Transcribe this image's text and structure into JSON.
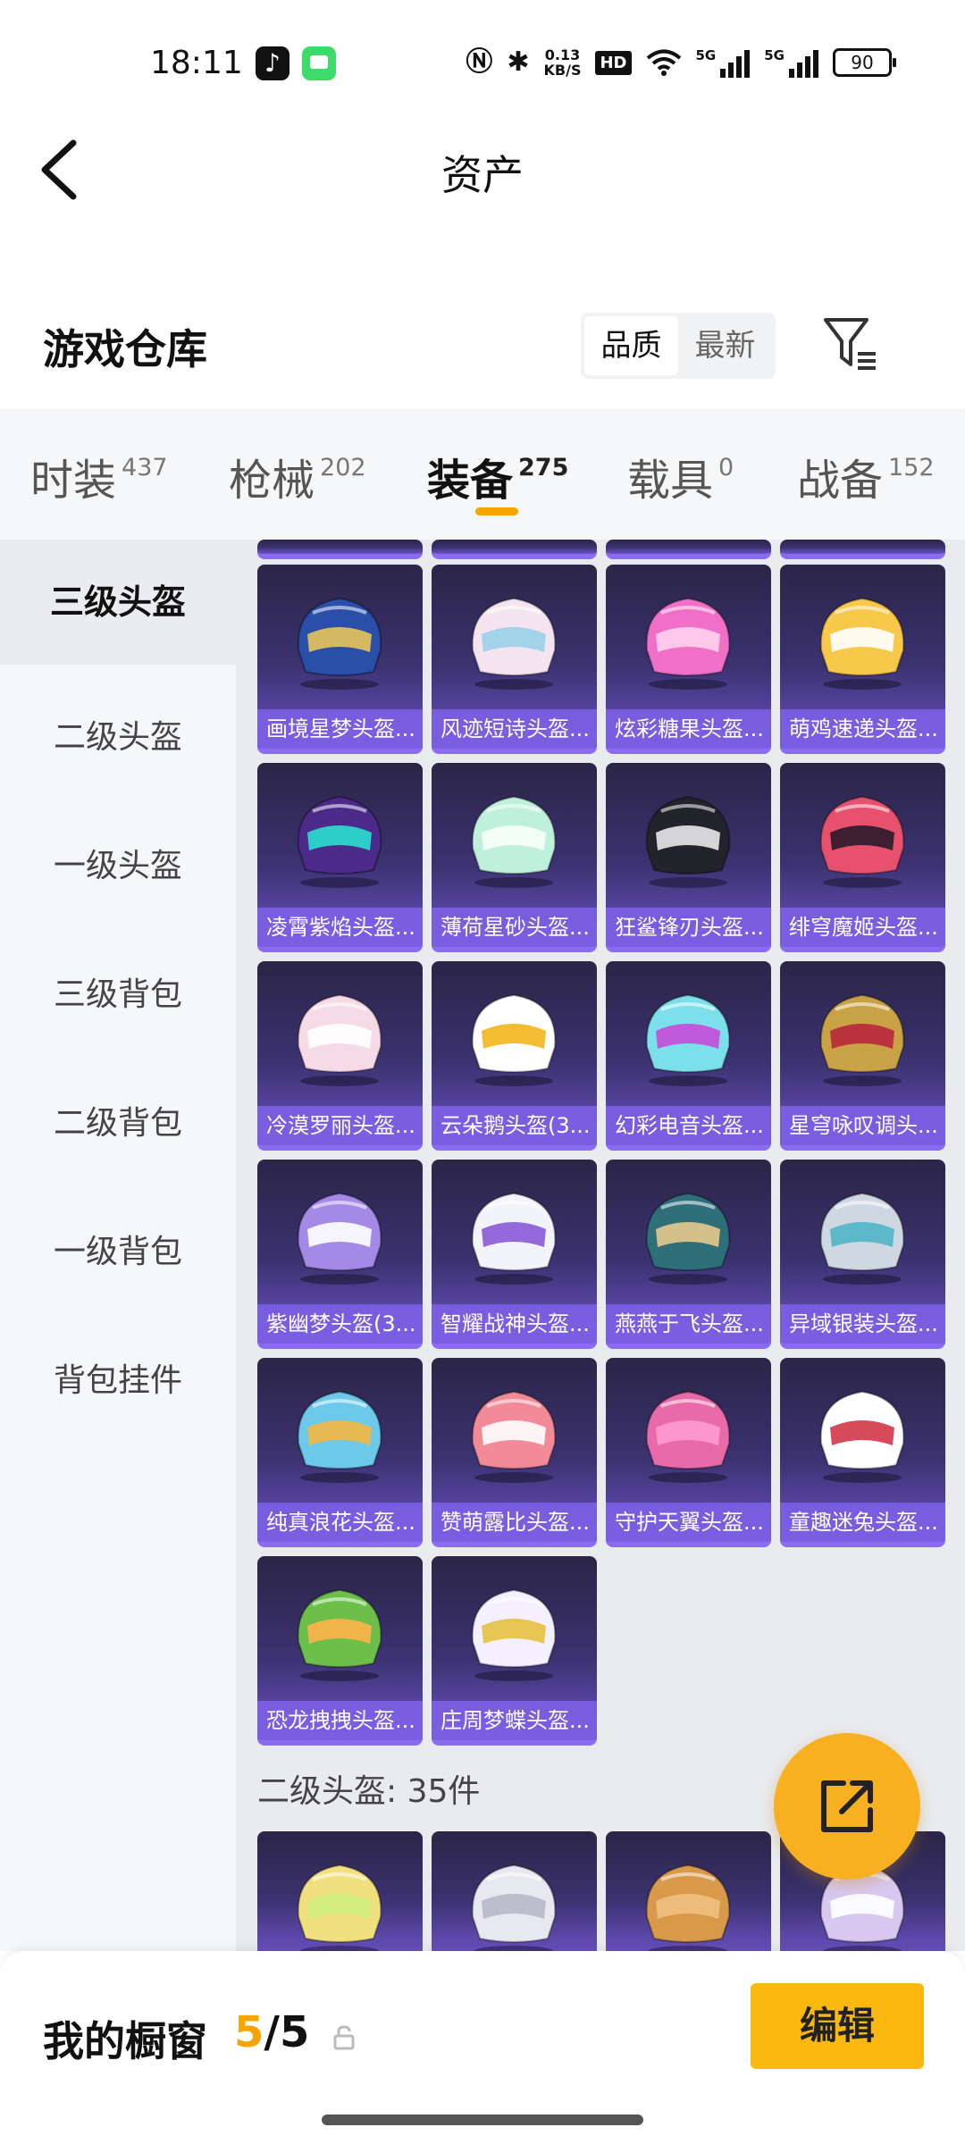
{
  "status_bar": {
    "time": "18:11",
    "net_speed_value": "0.13",
    "net_speed_unit": "KB/S",
    "hd_label": "HD",
    "sim1_label": "5G",
    "sim2_label": "5G",
    "battery": "90"
  },
  "header": {
    "title": "资产"
  },
  "section": {
    "title": "游戏仓库",
    "sort_options": [
      "品质",
      "最新"
    ],
    "sort_selected": "品质"
  },
  "tabs": [
    {
      "label": "时装",
      "count": "437"
    },
    {
      "label": "枪械",
      "count": "202"
    },
    {
      "label": "装备",
      "count": "275"
    },
    {
      "label": "载具",
      "count": "0"
    },
    {
      "label": "战备",
      "count": "152"
    }
  ],
  "active_tab": "装备",
  "sidebar": {
    "items": [
      "三级头盔",
      "二级头盔",
      "一级头盔",
      "三级背包",
      "二级背包",
      "一级背包",
      "背包挂件"
    ],
    "active": "三级头盔"
  },
  "grid": {
    "items": [
      {
        "name": "画境星梦头盔...",
        "art": "blue-gold-helmet-icon",
        "c1": "#2a4fa8",
        "c2": "#e8c35a"
      },
      {
        "name": "风迹短诗头盔...",
        "art": "pink-white-helmet-icon",
        "c1": "#f3e4ef",
        "c2": "#9ad0ea"
      },
      {
        "name": "炫彩糖果头盔...",
        "art": "candy-pink-helmet-icon",
        "c1": "#f06fc8",
        "c2": "#ffd1ee"
      },
      {
        "name": "萌鸡速递头盔...",
        "art": "chick-helmet-icon",
        "c1": "#f8c84a",
        "c2": "#ffffff"
      },
      {
        "name": "凌霄紫焰头盔...",
        "art": "purple-flame-helmet-icon",
        "c1": "#4c2a8a",
        "c2": "#2ae0d0"
      },
      {
        "name": "薄荷星砂头盔...",
        "art": "mint-helmet-icon",
        "c1": "#bff0dc",
        "c2": "#f7fff8"
      },
      {
        "name": "狂鲨锋刃头盔...",
        "art": "shark-helmet-icon",
        "c1": "#22232b",
        "c2": "#e8e8ea"
      },
      {
        "name": "绯穹魔姬头盔...",
        "art": "demon-cat-helmet-icon",
        "c1": "#e8516e",
        "c2": "#2a1a2a"
      },
      {
        "name": "冷漠罗丽头盔...",
        "art": "frilly-pink-helmet-icon",
        "c1": "#f6dbe6",
        "c2": "#ffffff"
      },
      {
        "name": "云朵鹅头盔(3...",
        "art": "goose-helmet-icon",
        "c1": "#ffffff",
        "c2": "#f2b51c"
      },
      {
        "name": "幻彩电音头盔...",
        "art": "dj-headset-helmet-icon",
        "c1": "#7ce0ea",
        "c2": "#c84ad8"
      },
      {
        "name": "星穹咏叹调头...",
        "art": "opera-mask-helmet-icon",
        "c1": "#c9a246",
        "c2": "#b7283c"
      },
      {
        "name": "紫幽梦头盔(3...",
        "art": "violet-dream-helmet-icon",
        "c1": "#a48ae6",
        "c2": "#ffffff"
      },
      {
        "name": "智耀战神头盔...",
        "art": "war-god-helmet-icon",
        "c1": "#f3f3fa",
        "c2": "#8a5ad8"
      },
      {
        "name": "燕燕于飞头盔...",
        "art": "swallow-helmet-icon",
        "c1": "#2f6f7a",
        "c2": "#e6c98c"
      },
      {
        "name": "异域银装头盔...",
        "art": "silver-helmet-icon",
        "c1": "#cfd8e2",
        "c2": "#4fb6c8"
      },
      {
        "name": "纯真浪花头盔...",
        "art": "wave-duck-helmet-icon",
        "c1": "#6cc9ea",
        "c2": "#f4b640"
      },
      {
        "name": "赞萌露比头盔...",
        "art": "ruby-pig-helmet-icon",
        "c1": "#f28a98",
        "c2": "#ffffff"
      },
      {
        "name": "守护天翼头盔...",
        "art": "pink-wing-helmet-icon",
        "c1": "#e86aa8",
        "c2": "#ff9bd0"
      },
      {
        "name": "童趣迷兔头盔...",
        "art": "rabbit-helmet-icon",
        "c1": "#ffffff",
        "c2": "#d2364a"
      },
      {
        "name": "恐龙拽拽头盔...",
        "art": "dino-helmet-icon",
        "c1": "#6cc04a",
        "c2": "#ffb24a"
      },
      {
        "name": "庄周梦蝶头盔...",
        "art": "butterfly-helmet-icon",
        "c1": "#f4f0ff",
        "c2": "#e6c040"
      }
    ]
  },
  "group_label": "二级头盔: 35件",
  "next_group": [
    {
      "art": "lemon-helmet-icon",
      "c1": "#f0e080",
      "c2": "#d0f080"
    },
    {
      "art": "silver-shell-helmet-icon",
      "c1": "#e8e8f0",
      "c2": "#b8b8c8"
    },
    {
      "art": "straw-hat-helmet-icon",
      "c1": "#d89a4a",
      "c2": "#f0c080"
    },
    {
      "art": "lilac-helmet-icon",
      "c1": "#d8c8f0",
      "c2": "#ffffff"
    }
  ],
  "bottom": {
    "showcase_label": "我的橱窗",
    "showcase_current": "5",
    "showcase_sep": "/",
    "showcase_total": "5",
    "edit_label": "编辑"
  }
}
